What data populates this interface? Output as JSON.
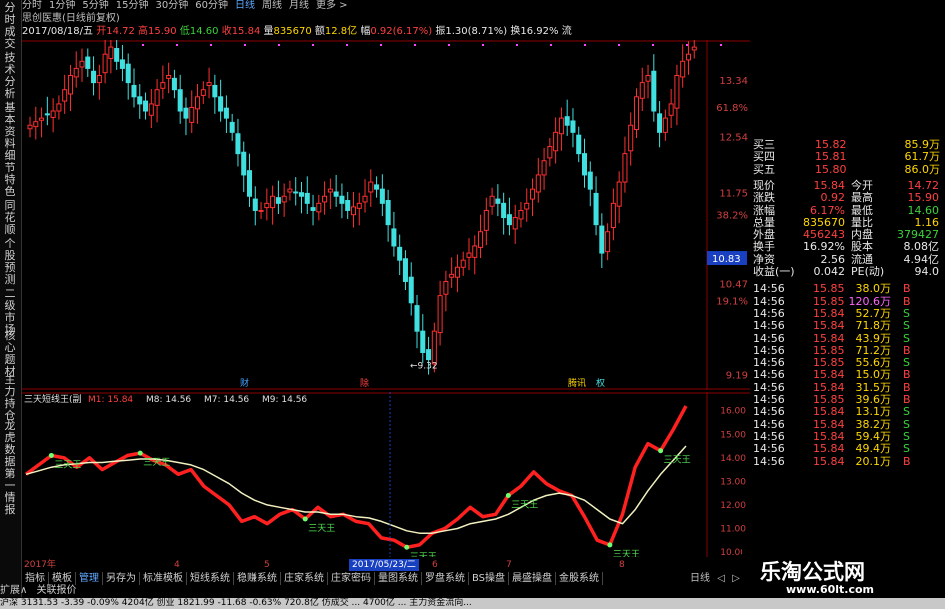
{
  "left_toolbar": [
    "分时成交",
    "技术分析",
    "基本资料",
    "细节特色",
    "同花顺",
    "个股预测",
    "二级市场",
    "核心题材",
    "主力持仓",
    "龙虎数据",
    "第一情报"
  ],
  "period_tabs": {
    "items": [
      "分时",
      "1分钟",
      "5分钟",
      "15分钟",
      "30分钟",
      "60分钟",
      "日线",
      "周线",
      "月线",
      "更多 >"
    ],
    "active": "日线"
  },
  "chart_title": "思创医惠(日线前复权)",
  "info_bar": {
    "date": "2017/08/18/五",
    "open_label": "开",
    "open": "14.72",
    "high_label": "高",
    "high": "15.90",
    "low_label": "低",
    "low": "14.60",
    "close_label": "收",
    "close": "15.84",
    "vol_label": "量",
    "vol": "835670",
    "amt_label": "额",
    "amt": "12.8亿",
    "chg_label": "幅",
    "chg": "0.92(6.17%)",
    "amp_label": "振",
    "amp": "1.30(8.71%)",
    "turn_label": "换",
    "turn": "16.92%",
    "tail": "流"
  },
  "price_axis": [
    {
      "v": 13.34,
      "t": "13.34"
    },
    {
      "v": 12.54,
      "t": "12.54"
    },
    {
      "v": 11.75,
      "t": "11.75"
    },
    {
      "v": 10.47,
      "t": "10.47"
    },
    {
      "v": 9.19,
      "t": "9.19"
    }
  ],
  "pct_axis": [
    {
      "v": 12.96,
      "t": "61.8%"
    },
    {
      "v": 11.44,
      "t": "38.2%"
    },
    {
      "v": 10.23,
      "t": "19.1%"
    }
  ],
  "current_price_tag": "10.83",
  "low_marker": "←9.32",
  "event_marks": [
    "财",
    "除",
    "腾讯",
    "权"
  ],
  "indicator": {
    "name": "三天短线王(副",
    "m1": "M1: 15.84",
    "m8": "M8: 14.56",
    "m7": "M7: 14.56",
    "m9": "M9: 14.56",
    "axis": [
      "16.00",
      "15.00",
      "14.00",
      "13.00",
      "12.00",
      "11.00",
      "10.00"
    ],
    "signal_label": "三天王"
  },
  "quote_panel": {
    "asks": [
      {
        "label": "买三",
        "price": "15.82",
        "vol": "85.9万"
      },
      {
        "label": "买四",
        "price": "15.81",
        "vol": "61.7万"
      },
      {
        "label": "买五",
        "price": "15.80",
        "vol": "86.0万"
      }
    ],
    "stats": [
      {
        "l1": "现价",
        "v1": "15.84",
        "l2": "今开",
        "v2": "14.72"
      },
      {
        "l1": "涨跌",
        "v1": "0.92",
        "l2": "最高",
        "v2": "15.90"
      },
      {
        "l1": "涨幅",
        "v1": "6.17%",
        "l2": "最低",
        "v2": "14.60"
      },
      {
        "l1": "总量",
        "v1": "835670",
        "l2": "量比",
        "v2": "1.16"
      },
      {
        "l1": "外盘",
        "v1": "456243",
        "l2": "内盘",
        "v2": "379427"
      },
      {
        "l1": "换手",
        "v1": "16.92%",
        "l2": "股本",
        "v2": "8.08亿"
      },
      {
        "l1": "净资",
        "v1": "2.56",
        "l2": "流通",
        "v2": "4.94亿"
      },
      {
        "l1": "收益(一)",
        "v1": "0.042",
        "l2": "PE(动)",
        "v2": "94.0"
      }
    ],
    "ticks": [
      {
        "t": "14:56",
        "p": "15.85",
        "v": "38.0万",
        "d": "B"
      },
      {
        "t": "14:56",
        "p": "15.85",
        "v": "120.6万",
        "d": "B"
      },
      {
        "t": "14:56",
        "p": "15.84",
        "v": "52.7万",
        "d": "S"
      },
      {
        "t": "14:56",
        "p": "15.84",
        "v": "71.8万",
        "d": "S"
      },
      {
        "t": "14:56",
        "p": "15.84",
        "v": "43.9万",
        "d": "S"
      },
      {
        "t": "14:56",
        "p": "15.85",
        "v": "71.2万",
        "d": "B"
      },
      {
        "t": "14:56",
        "p": "15.85",
        "v": "55.6万",
        "d": "S"
      },
      {
        "t": "14:56",
        "p": "15.84",
        "v": "15.0万",
        "d": "B"
      },
      {
        "t": "14:56",
        "p": "15.84",
        "v": "31.5万",
        "d": "B"
      },
      {
        "t": "14:56",
        "p": "15.85",
        "v": "39.6万",
        "d": "B"
      },
      {
        "t": "14:56",
        "p": "15.84",
        "v": "13.1万",
        "d": "S"
      },
      {
        "t": "14:56",
        "p": "15.84",
        "v": "38.2万",
        "d": "S"
      },
      {
        "t": "14:56",
        "p": "15.84",
        "v": "59.4万",
        "d": "S"
      },
      {
        "t": "14:56",
        "p": "15.84",
        "v": "49.4万",
        "d": "S"
      },
      {
        "t": "14:56",
        "p": "15.84",
        "v": "20.1万",
        "d": "B"
      }
    ]
  },
  "date_axis": {
    "start": "2017年",
    "m4": "4",
    "m5": "5",
    "m6": "6",
    "m7": "7",
    "m8": "8",
    "cursor": "2017/05/23/二"
  },
  "bottom_tabs": {
    "items": [
      "指标",
      "模板",
      "管理",
      "另存为",
      "标准模板",
      "短线系统",
      "稳赚系统",
      "庄家系统",
      "庄家密码",
      "量图系统",
      "罗盘系统",
      "BS操盘",
      "晨盛操盘",
      "金股系统"
    ],
    "active": "管理"
  },
  "right_bottom_tabs": [
    "日线",
    "◁",
    "▷"
  ],
  "ext_bar": [
    "扩展∧",
    "关联报价"
  ],
  "status_bar": "沪深 3131.53  -3.39  -0.09%  4204亿  创业 1821.99  -11.68  -0.63%  720.8亿  仿成交  ...  4700亿  ...  主力资金流向...",
  "watermark": {
    "line1": "乐淘公式网",
    "line2": "www.60lt.com"
  },
  "chart_data": [
    {
      "type": "candlestick",
      "title": "思创医惠(日线前复权)",
      "ylim": [
        9.0,
        13.9
      ],
      "note_values": "close values approximated per bar",
      "closes": [
        12.7,
        12.75,
        12.8,
        12.85,
        12.9,
        13.0,
        13.2,
        13.4,
        13.5,
        13.6,
        13.5,
        13.3,
        13.4,
        13.7,
        13.8,
        13.6,
        13.5,
        13.3,
        13.1,
        13.0,
        12.9,
        13.0,
        13.2,
        13.3,
        13.4,
        13.2,
        12.9,
        12.8,
        12.95,
        13.1,
        13.2,
        13.3,
        13.1,
        12.9,
        12.8,
        12.6,
        12.3,
        12.0,
        11.7,
        11.5,
        11.5,
        11.6,
        11.7,
        11.6,
        11.7,
        11.8,
        11.75,
        11.7,
        11.6,
        11.5,
        11.6,
        11.7,
        11.8,
        11.7,
        11.6,
        11.5,
        11.55,
        11.6,
        11.7,
        11.9,
        11.8,
        11.6,
        11.3,
        11.0,
        10.8,
        10.5,
        10.2,
        9.8,
        9.5,
        9.4,
        9.8,
        10.3,
        10.5,
        10.6,
        10.7,
        10.8,
        10.9,
        11.0,
        11.2,
        11.5,
        11.7,
        11.6,
        11.4,
        11.3,
        11.4,
        11.5,
        11.6,
        11.8,
        12.0,
        12.2,
        12.4,
        12.6,
        12.8,
        12.7,
        12.6,
        12.3,
        12.0,
        11.8,
        11.3,
        10.9,
        11.2,
        11.6,
        11.9,
        12.3,
        12.7,
        13.1,
        13.3,
        13.4,
        12.9,
        12.6,
        12.8,
        13.0,
        13.4,
        13.6,
        13.7,
        13.8
      ]
    },
    {
      "type": "line",
      "title": "三天短线王",
      "ylim": [
        10.0,
        16.2
      ],
      "series": [
        {
          "name": "M1",
          "values": [
            13.3,
            13.7,
            14.1,
            14.0,
            13.6,
            14.0,
            13.5,
            13.8,
            14.1,
            14.2,
            13.9,
            13.7,
            13.3,
            13.5,
            12.8,
            12.4,
            12.0,
            11.3,
            11.5,
            11.2,
            11.6,
            11.8,
            11.4,
            11.9,
            11.5,
            11.6,
            11.3,
            11.2,
            10.6,
            10.5,
            10.2,
            10.3,
            10.8,
            11.0,
            11.4,
            11.9,
            11.5,
            11.6,
            12.4,
            12.8,
            13.4,
            12.9,
            12.6,
            12.4,
            11.5,
            10.5,
            10.3,
            11.6,
            13.6,
            14.6,
            14.3,
            15.2,
            16.2
          ]
        },
        {
          "name": "M8",
          "values": [
            13.3,
            13.45,
            13.6,
            13.7,
            13.75,
            13.8,
            13.8,
            13.85,
            13.9,
            13.95,
            13.95,
            13.9,
            13.8,
            13.7,
            13.5,
            13.2,
            12.9,
            12.5,
            12.2,
            12.0,
            11.9,
            11.8,
            11.7,
            11.7,
            11.6,
            11.6,
            11.5,
            11.45,
            11.3,
            11.1,
            10.9,
            10.8,
            10.8,
            10.9,
            11.0,
            11.2,
            11.3,
            11.4,
            11.6,
            11.9,
            12.2,
            12.4,
            12.5,
            12.4,
            12.2,
            11.8,
            11.4,
            11.2,
            11.8,
            12.6,
            13.3,
            13.9,
            14.5
          ]
        }
      ]
    }
  ]
}
